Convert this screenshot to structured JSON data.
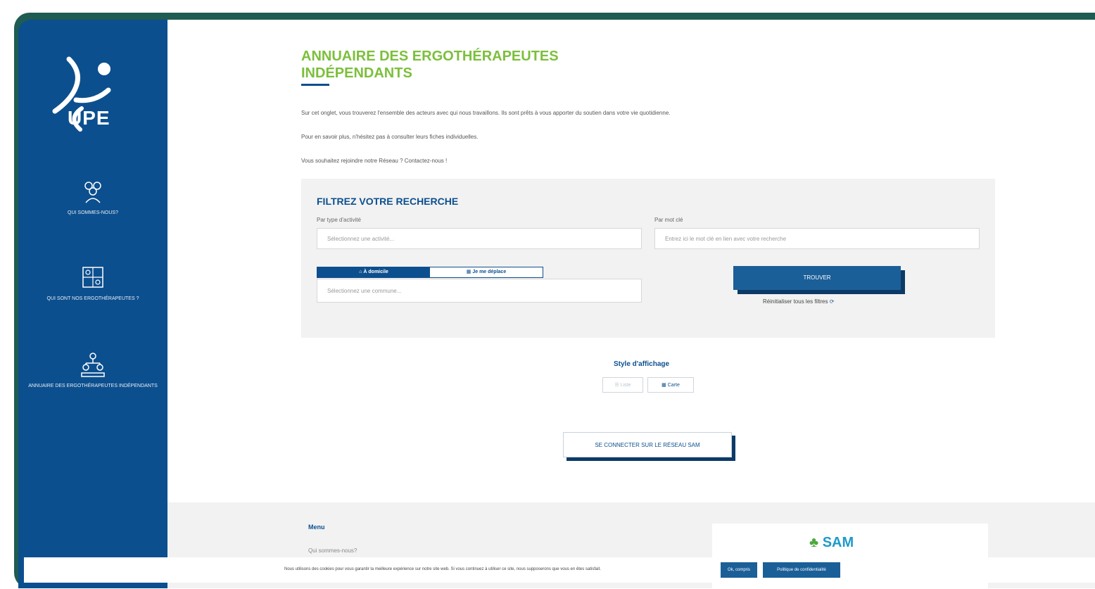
{
  "sidebar": {
    "logo_text": "UPE",
    "items": [
      {
        "label": "QUI SOMMES-NOUS?",
        "icon": "people-group-icon"
      },
      {
        "label": "QUI SONT NOS ERGOTHÉRAPEUTES ?",
        "icon": "puzzle-people-icon"
      },
      {
        "label": "ANNUAIRE DES ERGOTHÉRAPEUTES INDÉPENDANTS",
        "icon": "network-icon"
      }
    ]
  },
  "page": {
    "title_line1": "ANNUAIRE DES ERGOTHÉRAPEUTES",
    "title_line2": "INDÉPENDANTS",
    "intro_p1": "Sur cet onglet, vous trouverez l'ensemble des acteurs avec qui nous travaillons. Ils sont prêts à vous apporter du soutien dans votre vie quotidienne.",
    "intro_p2": "Pour en savoir plus, n'hésitez pas à consulter leurs fiches individuelles.",
    "intro_p3": "Vous souhaitez rejoindre notre Réseau ? Contactez-nous !"
  },
  "filter": {
    "title": "FILTREZ VOTRE RECHERCHE",
    "activity_label": "Par type d'activité",
    "activity_placeholder": "Sélectionnez une activité...",
    "keyword_label": "Par mot clé",
    "keyword_placeholder": "Entrez ici le mot clé en lien avec votre recherche",
    "tab_home": "À domicile",
    "tab_move": "Je me déplace",
    "commune_placeholder": "Sélectionnez une commune...",
    "search_button": "TROUVER",
    "reset_text": "Réinitialiser tous les filtres"
  },
  "display": {
    "label": "Style d'affichage",
    "list_label": "Liste",
    "grid_label": "Carte"
  },
  "connect_button": "SE CONNECTER SUR LE RÉSEAU SAM",
  "footer": {
    "menu_title": "Menu",
    "link_1": "Qui sommes-nous?",
    "sam_logo_text": "SAM"
  },
  "cookie": {
    "text": "Nous utilisons des cookies pour vous garantir la meilleure expérience sur notre site web. Si vous continuez à utiliser ce site, nous supposerons que vous en êtes satisfait.",
    "accept_button": "Ok, compris",
    "policy_button": "Politique de confidentialité"
  },
  "colors": {
    "sidebar_blue": "#0c4f8e",
    "title_green": "#7cbf3c",
    "button_blue": "#1b5f98"
  }
}
